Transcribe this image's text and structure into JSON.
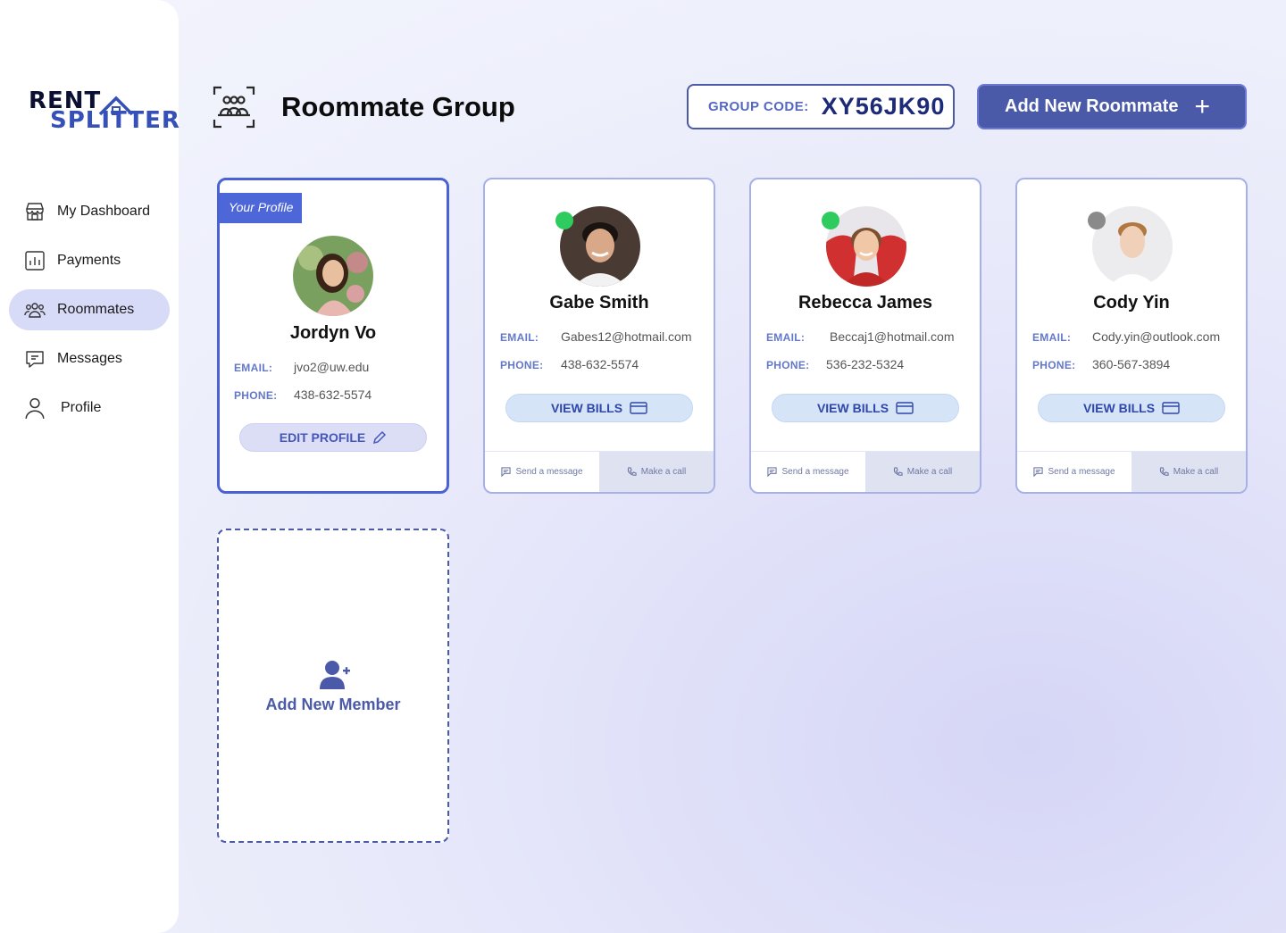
{
  "brand": {
    "line1": "RENT",
    "line2": "SPLITTER"
  },
  "sidebar": {
    "items": [
      {
        "label": "My Dashboard",
        "icon": "store-icon",
        "active": false
      },
      {
        "label": "Payments",
        "icon": "chart-icon",
        "active": false
      },
      {
        "label": "Roommates",
        "icon": "users-icon",
        "active": true
      },
      {
        "label": "Messages",
        "icon": "message-icon",
        "active": false
      },
      {
        "label": "Profile",
        "icon": "user-icon",
        "active": false
      }
    ]
  },
  "header": {
    "title": "Roommate Group",
    "group_code_label": "GROUP CODE:",
    "group_code_value": "XY56JK90",
    "add_button_label": "Add New Roommate",
    "add_button_icon": "plus-icon"
  },
  "labels": {
    "email": "EMAIL:",
    "phone": "PHONE:",
    "view_bills": "VIEW BILLS",
    "edit_profile": "EDIT PROFILE",
    "send_message": "Send a message",
    "make_call": "Make a call",
    "your_profile": "Your Profile"
  },
  "my_profile": {
    "name": "Jordyn Vo",
    "email": "jvo2@uw.edu",
    "phone": "438-632-5574"
  },
  "roommates": [
    {
      "name": "Gabe Smith",
      "email": "Gabes12@hotmail.com",
      "phone": "438-632-5574",
      "status": "online",
      "status_color": "#2ecc5e"
    },
    {
      "name": "Rebecca James",
      "email": "Beccaj1@hotmail.com",
      "phone": "536-232-5324",
      "status": "online",
      "status_color": "#2ecc5e"
    },
    {
      "name": "Cody Yin",
      "email": "Cody.yin@outlook.com",
      "phone": "360-567-3894",
      "status": "offline",
      "status_color": "#8a8a8a"
    }
  ],
  "add_member": {
    "label": "Add New Member",
    "icon": "add-user-icon"
  },
  "colors": {
    "accent": "#4a5aa8",
    "primary": "#4e67d8",
    "online": "#2ecc5e",
    "offline": "#8a8a8a"
  }
}
